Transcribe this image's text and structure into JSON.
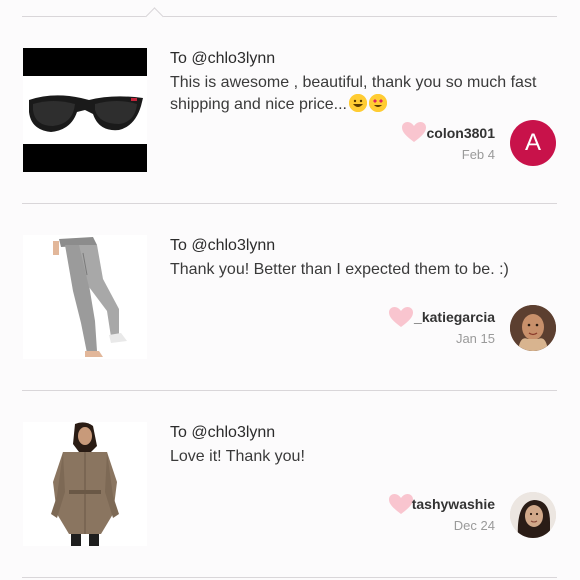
{
  "reviews": [
    {
      "recipient": "To @chlo3lynn",
      "message": "This is awesome , beautiful, thank you so much fast shipping and nice price...",
      "message_emoji": [
        "grinning-face",
        "heart-eyes-face"
      ],
      "username": "colon3801",
      "date": "Feb 4",
      "avatar_letter": "A",
      "avatar_color": "#c8124a",
      "item": "sunglasses"
    },
    {
      "recipient": "To @chlo3lynn",
      "message": "Thank you! Better than I expected them to be. :)",
      "username": "_katiegarcia",
      "date": "Jan 15",
      "item": "gray leggings"
    },
    {
      "recipient": "To @chlo3lynn",
      "message": "Love it! Thank you!",
      "username": "tashywashie",
      "date": "Dec 24",
      "item": "tan jacket"
    }
  ],
  "colors": {
    "heart": "#f9c5cf",
    "divider": "#d9d6d9",
    "background": "#fcfbfc"
  }
}
